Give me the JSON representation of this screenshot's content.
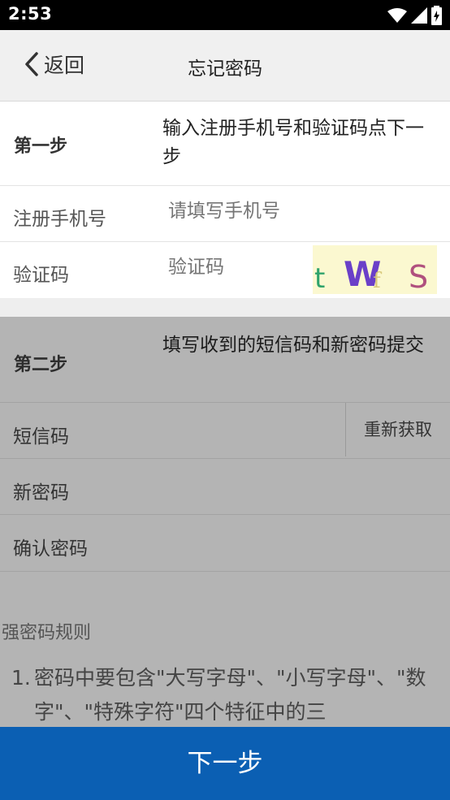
{
  "status_bar": {
    "time": "2:53"
  },
  "nav": {
    "back_label": "返回",
    "title": "忘记密码"
  },
  "step1": {
    "label": "第一步",
    "description": "输入注册手机号和验证码点下一步",
    "phone": {
      "label": "注册手机号",
      "placeholder": "请填写手机号"
    },
    "captcha": {
      "label": "验证码",
      "placeholder": "验证码",
      "image_text": "t Wf S"
    }
  },
  "step2": {
    "label": "第二步",
    "description": "填写收到的短信码和新密码提交",
    "sms": {
      "label": "短信码",
      "resend_label": "重新获取"
    },
    "new_password": {
      "label": "新密码"
    },
    "confirm_password": {
      "label": "确认密码"
    }
  },
  "rules": {
    "title": "强密码规则",
    "items": [
      {
        "num": "1.",
        "text": "密码中要包含\"大写字母\"、\"小写字母\"、\"数字\"、\"特殊字符\"四个特征中的三"
      }
    ]
  },
  "footer": {
    "next_label": "下一步"
  },
  "colors": {
    "primary": "#0b5fb3",
    "overlay": "#b4b4b4",
    "captcha_bg": "#fbf8d0"
  }
}
